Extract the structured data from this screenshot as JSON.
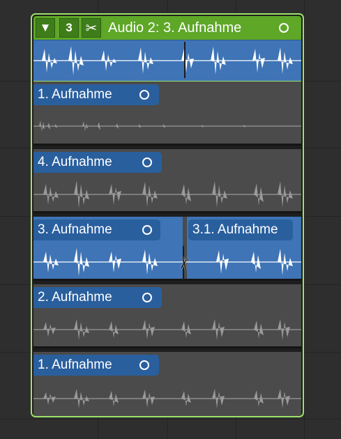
{
  "folder": {
    "disclosure_icon": "triangle-down-icon",
    "disclosure_glyph": "▼",
    "take_count": "3",
    "quick_swipe_icon": "scissors-icon",
    "quick_swipe_glyph": "✂",
    "title": "Audio 2: 3. Aufnahme",
    "header_color": "#5ea727",
    "border_color": "#9de36a"
  },
  "takes": [
    {
      "label": "1. Aufnahme",
      "level": "quiet"
    },
    {
      "label": "4. Aufnahme",
      "level": "muted"
    },
    {
      "label": "3. Aufnahme",
      "split_label": "3.1. Aufnahme",
      "level": "selected"
    },
    {
      "label": "2. Aufnahme",
      "level": "muted"
    },
    {
      "label": "1. Aufnahme",
      "level": "muted"
    }
  ],
  "colors": {
    "selected_region": "#3f74b6",
    "unselected_region": "#4b4b4b",
    "waveform_selected": "#ffffff",
    "waveform_unselected": "#9a9a9a"
  },
  "cursor_icon": "scissors-cursor-icon"
}
